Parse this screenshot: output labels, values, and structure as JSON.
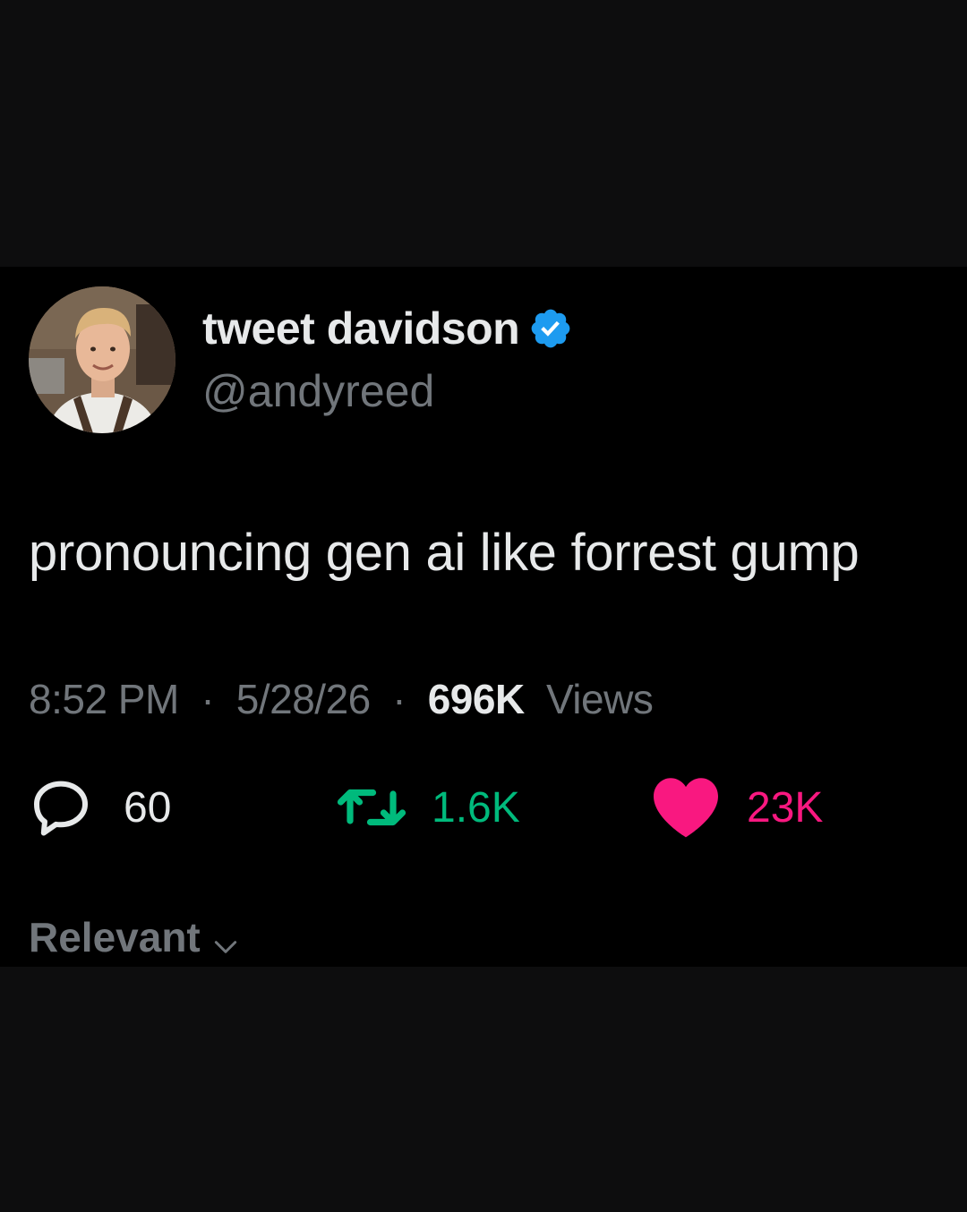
{
  "user": {
    "display_name": "tweet davidson",
    "handle": "@andyreed",
    "verified_icon": "verified-badge-icon",
    "avatar": "profile-photo"
  },
  "tweet": {
    "text": "pronouncing gen ai like forrest gump",
    "time": "8:52 PM",
    "separator": "·",
    "date": "5/28/26",
    "views_count": "696K",
    "views_label": "Views"
  },
  "actions": {
    "replies": "60",
    "retweets": "1.6K",
    "likes": "23K"
  },
  "sort": {
    "label": "Relevant"
  },
  "colors": {
    "background": "#000000",
    "text_primary": "#e7e9ea",
    "text_secondary": "#71767b",
    "verified": "#1d9bf0",
    "retweet": "#00ba7c",
    "like": "#f91880"
  }
}
